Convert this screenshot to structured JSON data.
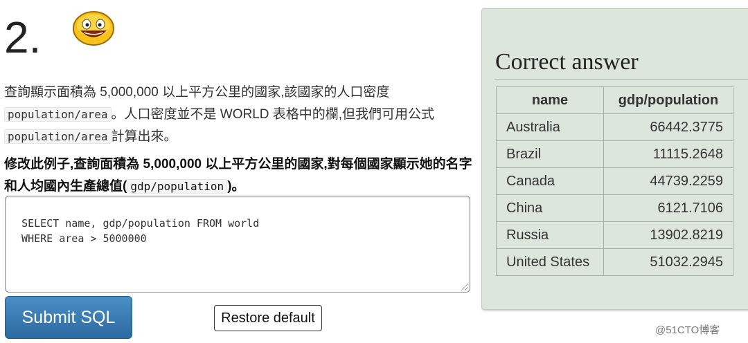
{
  "question": {
    "number": "2.",
    "smiley_icon": "smiley-face-icon",
    "description": [
      {
        "type": "text",
        "value": "查詢顯示面積為 5,000,000 以上平方公里的國家,該國家的人口密度"
      },
      {
        "type": "code",
        "value": "population/area"
      },
      {
        "type": "text",
        "value": "。人口密度並不是 WORLD 表格中的欄,但我們可用公式"
      },
      {
        "type": "code",
        "value": "population/area"
      },
      {
        "type": "text",
        "value": "計算出來。"
      }
    ],
    "task_text_1": "修改此例子,查詢面積為 5,000,000 以上平方公里的國家,對每個國家顯示她的名字和人均國內生產總值(",
    "task_code": "gdp/population",
    "task_text_2": ")。"
  },
  "editor": {
    "sql": "SELECT name, gdp/population FROM world\n  WHERE area > 5000000"
  },
  "buttons": {
    "submit_label": "Submit SQL",
    "restore_label": "Restore default"
  },
  "answer": {
    "title": "Correct answer",
    "columns": [
      "name",
      "gdp/population"
    ],
    "rows": [
      [
        "Australia",
        "66442.3775"
      ],
      [
        "Brazil",
        "11115.2648"
      ],
      [
        "Canada",
        "44739.2259"
      ],
      [
        "China",
        "6121.7106"
      ],
      [
        "Russia",
        "13902.8219"
      ],
      [
        "United States",
        "51032.2945"
      ]
    ]
  },
  "watermark": "@51CTO博客",
  "colors": {
    "panel_bg": "#dde6dd",
    "submit_bg": "#2c6aa0"
  }
}
